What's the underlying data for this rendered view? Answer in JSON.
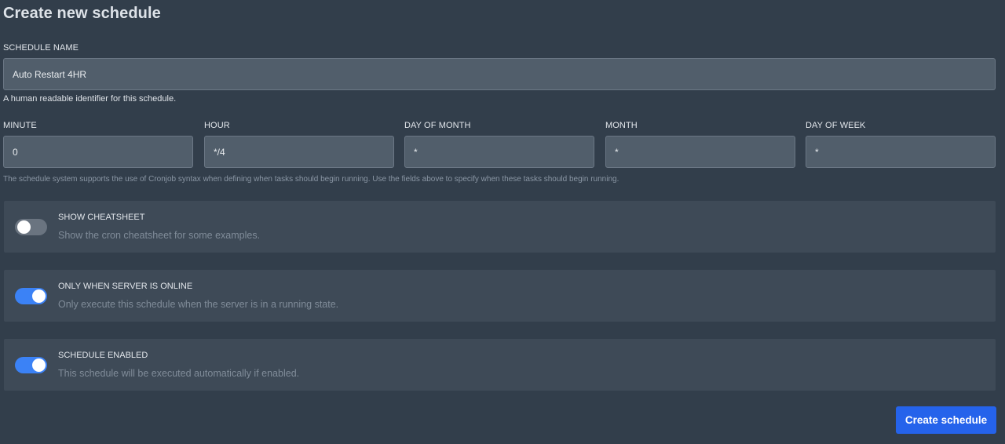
{
  "page": {
    "title": "Create new schedule"
  },
  "schedule_name": {
    "label": "SCHEDULE NAME",
    "value": "Auto Restart 4HR",
    "help": "A human readable identifier for this schedule."
  },
  "cron": {
    "fields": [
      {
        "label": "MINUTE",
        "value": "0"
      },
      {
        "label": "HOUR",
        "value": "*/4"
      },
      {
        "label": "DAY OF MONTH",
        "value": "*"
      },
      {
        "label": "MONTH",
        "value": "*"
      },
      {
        "label": "DAY OF WEEK",
        "value": "*"
      }
    ],
    "help": "The schedule system supports the use of Cronjob syntax when defining when tasks should begin running. Use the fields above to specify when these tasks should begin running."
  },
  "toggles": [
    {
      "title": "SHOW CHEATSHEET",
      "description": "Show the cron cheatsheet for some examples.",
      "enabled": false
    },
    {
      "title": "ONLY WHEN SERVER IS ONLINE",
      "description": "Only execute this schedule when the server is in a running state.",
      "enabled": true
    },
    {
      "title": "SCHEDULE ENABLED",
      "description": "This schedule will be executed automatically if enabled.",
      "enabled": true
    }
  ],
  "submit": {
    "label": "Create schedule"
  },
  "colors": {
    "accent": "#2563eb",
    "toggle_on": "#3b82f6",
    "toggle_off": "#6a7480",
    "background": "#323e4b"
  }
}
